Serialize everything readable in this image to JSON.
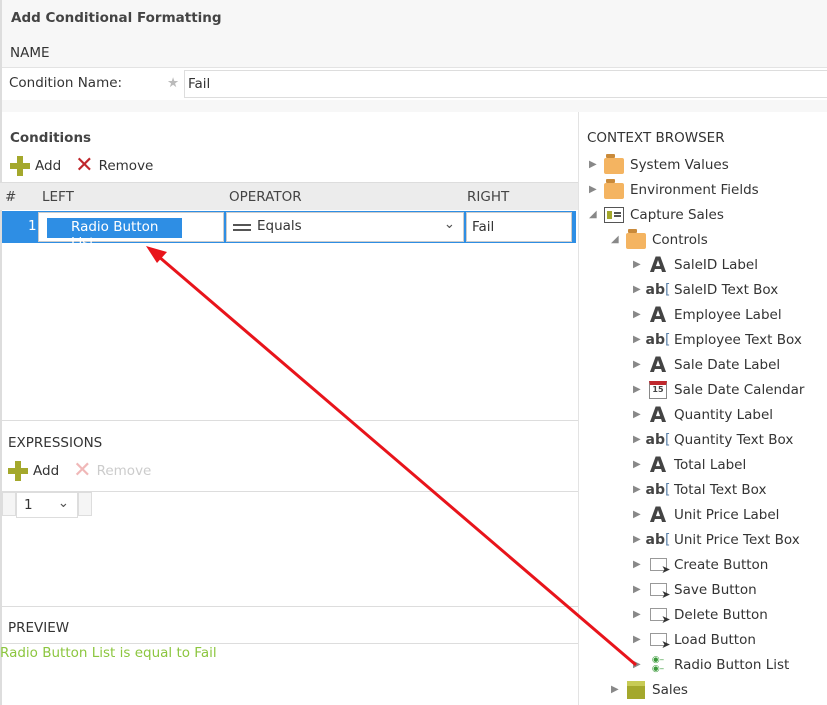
{
  "title": "Add Conditional Formatting",
  "name_section": {
    "header": "NAME",
    "label": "Condition Name:",
    "value": "Fail"
  },
  "conditions": {
    "header": "Conditions",
    "add": "Add",
    "remove": "Remove",
    "columns": [
      "#",
      "LEFT",
      "OPERATOR",
      "RIGHT"
    ],
    "rows": [
      {
        "num": "1",
        "left": "Radio Button List",
        "operator": "Equals",
        "right": "Fail"
      }
    ]
  },
  "expressions": {
    "header": "EXPRESSIONS",
    "add": "Add",
    "remove": "Remove",
    "select_value": "1"
  },
  "preview": {
    "header": "PREVIEW",
    "text": "Radio Button List is equal to Fail",
    "color": "#8cc63f"
  },
  "context_browser": {
    "header": "CONTEXT BROWSER",
    "items": [
      {
        "label": "System Values",
        "icon": "folder",
        "level": 0,
        "expanded": false
      },
      {
        "label": "Environment Fields",
        "icon": "folder",
        "level": 0,
        "expanded": false
      },
      {
        "label": "Capture Sales",
        "icon": "form",
        "level": 0,
        "expanded": true
      },
      {
        "label": "Controls",
        "icon": "folder",
        "level": 1,
        "expanded": true
      },
      {
        "label": "SaleID Label",
        "icon": "label",
        "level": 2,
        "expanded": false
      },
      {
        "label": "SaleID Text Box",
        "icon": "textbox",
        "level": 2,
        "expanded": false
      },
      {
        "label": "Employee Label",
        "icon": "label",
        "level": 2,
        "expanded": false
      },
      {
        "label": "Employee Text Box",
        "icon": "textbox",
        "level": 2,
        "expanded": false
      },
      {
        "label": "Sale Date Label",
        "icon": "label",
        "level": 2,
        "expanded": false
      },
      {
        "label": "Sale Date Calendar",
        "icon": "calendar",
        "level": 2,
        "expanded": false
      },
      {
        "label": "Quantity Label",
        "icon": "label",
        "level": 2,
        "expanded": false
      },
      {
        "label": "Quantity Text Box",
        "icon": "textbox",
        "level": 2,
        "expanded": false
      },
      {
        "label": "Total Label",
        "icon": "label",
        "level": 2,
        "expanded": false
      },
      {
        "label": "Total Text Box",
        "icon": "textbox",
        "level": 2,
        "expanded": false
      },
      {
        "label": "Unit Price Label",
        "icon": "label",
        "level": 2,
        "expanded": false
      },
      {
        "label": "Unit Price Text Box",
        "icon": "textbox",
        "level": 2,
        "expanded": false
      },
      {
        "label": "Create Button",
        "icon": "button",
        "level": 2,
        "expanded": false
      },
      {
        "label": "Save Button",
        "icon": "button",
        "level": 2,
        "expanded": false
      },
      {
        "label": "Delete Button",
        "icon": "button",
        "level": 2,
        "expanded": false
      },
      {
        "label": "Load Button",
        "icon": "button",
        "level": 2,
        "expanded": false
      },
      {
        "label": "Radio Button List",
        "icon": "radio",
        "level": 2,
        "expanded": false
      },
      {
        "label": "Sales",
        "icon": "smartobject",
        "level": 1,
        "expanded": false
      }
    ]
  }
}
